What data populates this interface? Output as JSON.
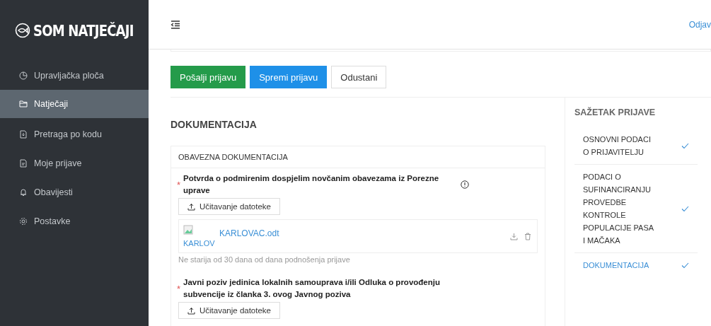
{
  "sidebar": {
    "logo": "SOM NATJEČAJI",
    "items": [
      {
        "label": "Upravljačka ploča",
        "selected": false
      },
      {
        "label": "Natječaji",
        "selected": true
      },
      {
        "label": "Pretraga po kodu",
        "selected": false
      },
      {
        "label": "Moje prijave",
        "selected": false
      },
      {
        "label": "Obavijesti",
        "selected": false
      },
      {
        "label": "Postavke",
        "selected": false
      }
    ]
  },
  "header": {
    "logout": "Odjav"
  },
  "actions": [
    {
      "label": "Pošalji prijavu",
      "kind": "success"
    },
    {
      "label": "Spremi prijavu",
      "kind": "primary"
    },
    {
      "label": "Odustani",
      "kind": "default"
    }
  ],
  "section": {
    "title": "DOKUMENTACIJA",
    "panel_title": "OBAVEZNA DOKUMENTACIJA",
    "documents": [
      {
        "label": "Potvrda o podmirenim dospjelim novčanim obavezama iz Porezne uprave",
        "required_mark": "*",
        "info": true,
        "upload": "Učitavanje datoteke",
        "files": [
          {
            "alt": "KARLOV",
            "name": "KARLOVAC.odt"
          }
        ],
        "hint": "Ne starija od 30 dana od dana podnošenja prijave"
      },
      {
        "label": "Javni poziv jedinica lokalnih samouprava i/ili Odluka o provođenju subvencije iz članka 3. ovog Javnog poziva",
        "required_mark": "*",
        "info": false,
        "upload": "Učitavanje datoteke"
      }
    ]
  },
  "summary": {
    "title": "SAŽETAK PRIJAVE",
    "items": [
      {
        "label": "OSNOVNI PODACI O PRIJAVITELJU",
        "checked": true,
        "selected": false
      },
      {
        "label": "PODACI O SUFINANCIRANJU PROVEDBE KONTROLE POPULACIJE PASA I MAČAKA",
        "checked": true,
        "selected": false
      },
      {
        "label": "DOKUMENTACIJA",
        "checked": true,
        "selected": true
      }
    ]
  }
}
